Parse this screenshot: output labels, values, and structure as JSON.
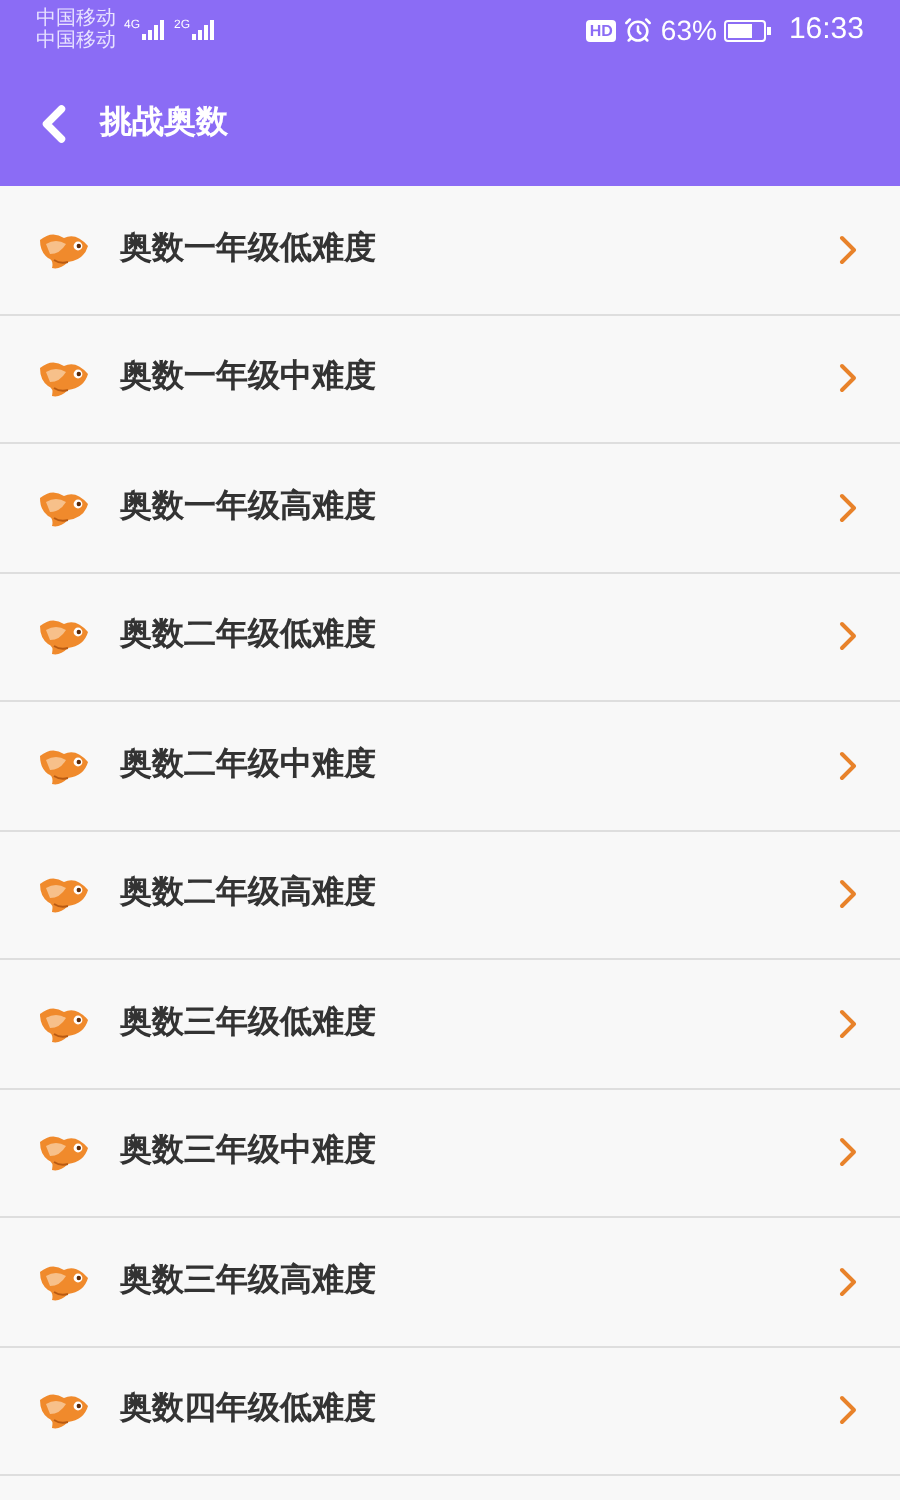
{
  "status_bar": {
    "carriers": [
      {
        "name": "中国移动",
        "network": "4G"
      },
      {
        "name": "中国移动",
        "network": "2G"
      }
    ],
    "hd": "HD",
    "battery_text": "63%",
    "time": "16:33"
  },
  "header": {
    "title": "挑战奥数"
  },
  "items": [
    {
      "label": "奥数一年级低难度"
    },
    {
      "label": "奥数一年级中难度"
    },
    {
      "label": "奥数一年级高难度"
    },
    {
      "label": "奥数二年级低难度"
    },
    {
      "label": "奥数二年级中难度"
    },
    {
      "label": "奥数二年级高难度"
    },
    {
      "label": "奥数三年级低难度"
    },
    {
      "label": "奥数三年级中难度"
    },
    {
      "label": "奥数三年级高难度"
    },
    {
      "label": "奥数四年级低难度"
    }
  ]
}
